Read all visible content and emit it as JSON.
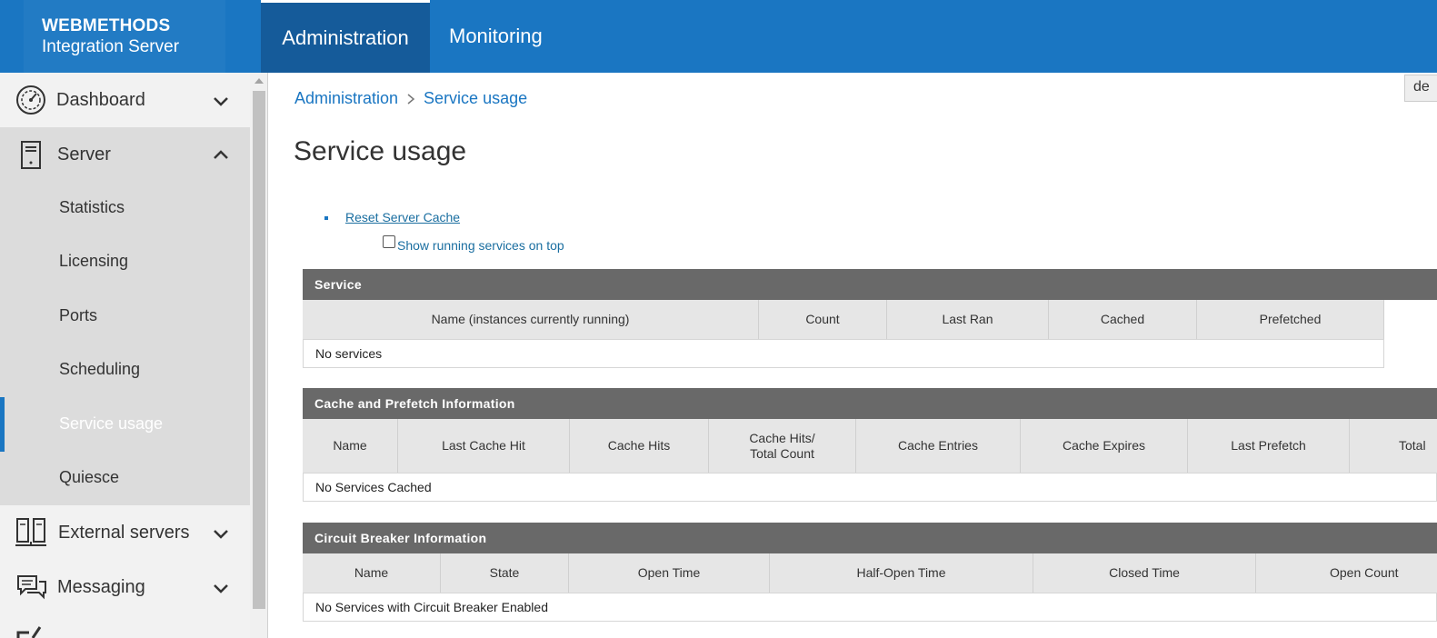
{
  "brand": {
    "line1": "WEBMETHODS",
    "line2": "Integration Server"
  },
  "tabs": [
    {
      "label": "Administration",
      "active": true
    },
    {
      "label": "Monitoring",
      "active": false
    }
  ],
  "sidebar": {
    "items": [
      {
        "label": "Dashboard",
        "icon": "dashboard-gauge-icon",
        "expanded": false
      },
      {
        "label": "Server",
        "icon": "server-icon",
        "expanded": true
      },
      {
        "label": "External servers",
        "icon": "external-servers-icon",
        "expanded": false
      },
      {
        "label": "Messaging",
        "icon": "messaging-icon",
        "expanded": false
      }
    ],
    "server_sub_items": [
      {
        "label": "Statistics"
      },
      {
        "label": "Licensing"
      },
      {
        "label": "Ports"
      },
      {
        "label": "Scheduling"
      },
      {
        "label": "Service usage",
        "active": true
      },
      {
        "label": "Quiesce"
      }
    ]
  },
  "breadcrumb": {
    "root": "Administration",
    "current": "Service usage"
  },
  "page_title": "Service usage",
  "corner_tab": "de",
  "actions": {
    "reset_cache": "Reset Server Cache",
    "show_running_label": "Show running services on top",
    "show_running_checked": false
  },
  "tables": {
    "service": {
      "title": "Service",
      "columns": [
        "Name (instances currently running)",
        "Count",
        "Last Ran",
        "Cached",
        "Prefetched"
      ],
      "empty": "No services"
    },
    "cache": {
      "title": "Cache and Prefetch Information",
      "columns": [
        "Name",
        "Last Cache Hit",
        "Cache Hits",
        "Cache Hits/\nTotal Count",
        "Cache Entries",
        "Cache Expires",
        "Last Prefetch",
        "Total"
      ],
      "empty": "No Services Cached"
    },
    "circuit": {
      "title": "Circuit Breaker Information",
      "columns": [
        "Name",
        "State",
        "Open Time",
        "Half-Open Time",
        "Closed Time",
        "Open Count"
      ],
      "empty": "No Services with Circuit Breaker Enabled"
    }
  },
  "colors": {
    "brand_blue": "#1a76c2",
    "active_tab": "#155b9a",
    "table_header": "#696969"
  }
}
